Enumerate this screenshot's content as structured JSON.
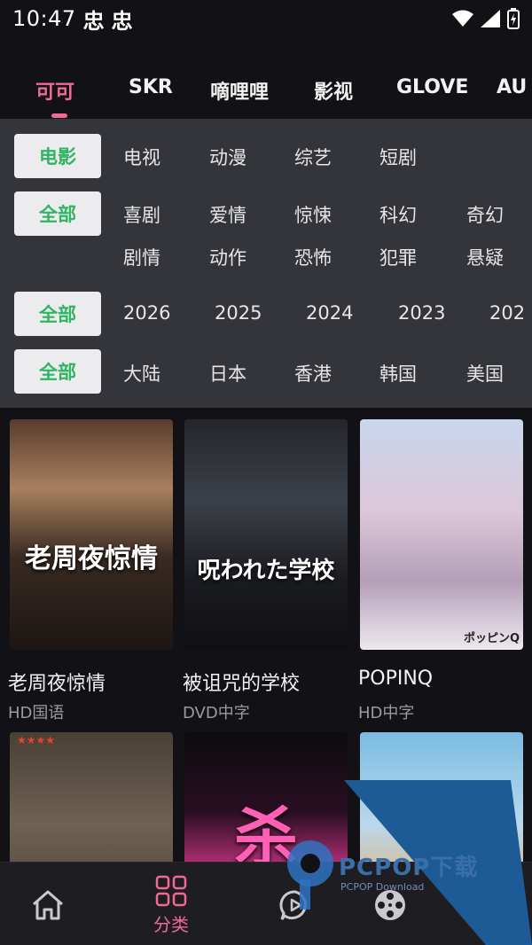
{
  "status_bar": {
    "time": "10:47",
    "notif_glyphs": [
      "忠",
      "忠"
    ]
  },
  "tabs": [
    {
      "label": "可可",
      "active": true
    },
    {
      "label": "SKR"
    },
    {
      "label": "嘀哩哩"
    },
    {
      "label": "影视"
    },
    {
      "label": "GLOVE"
    },
    {
      "label": "AU"
    }
  ],
  "filters": {
    "type": {
      "selected": "电影",
      "options": [
        "电视",
        "动漫",
        "综艺",
        "短剧"
      ]
    },
    "genre": {
      "selected": "全部",
      "row1": [
        "喜剧",
        "爱情",
        "惊悚",
        "科幻",
        "奇幻"
      ],
      "row2": [
        "剧情",
        "动作",
        "恐怖",
        "犯罪",
        "悬疑"
      ]
    },
    "year": {
      "selected": "全部",
      "options": [
        "2026",
        "2025",
        "2024",
        "2023",
        "202"
      ]
    },
    "region": {
      "selected": "全部",
      "options": [
        "大陆",
        "日本",
        "香港",
        "韩国",
        "美国"
      ]
    }
  },
  "movies": [
    {
      "title": "老周夜惊情",
      "quality": "HD国语",
      "poster_text": "老周夜惊情"
    },
    {
      "title": "被诅咒的学校",
      "quality": "DVD中字",
      "poster_text": "呪われた学校"
    },
    {
      "title": "POPINQ",
      "quality": "HD中字",
      "poster_text": "ポッピンQ"
    },
    {
      "title": "",
      "quality": "",
      "poster_text": "★★★★"
    },
    {
      "title": "",
      "quality": "",
      "poster_text": "杀"
    },
    {
      "title": "",
      "quality": "",
      "poster_text": ""
    }
  ],
  "bottom_nav": {
    "active_label": "分类"
  },
  "watermark": {
    "brand": "PCPOP下载",
    "sub": "PCPOP Download"
  },
  "colors": {
    "accent": "#f06a93",
    "chip_text": "#2fb462",
    "panel_bg": "#34353b",
    "page_bg": "#121216"
  }
}
